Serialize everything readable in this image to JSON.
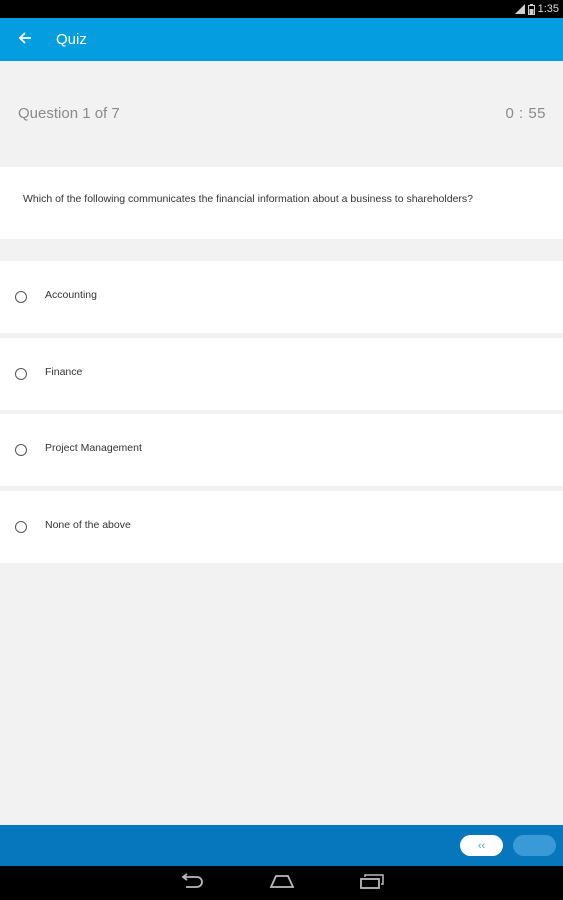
{
  "status_bar": {
    "time": "1:35",
    "icons": [
      "signal-icon",
      "battery-icon"
    ]
  },
  "app_bar": {
    "title": "Quiz",
    "back_icon": "arrow-left-icon"
  },
  "quiz": {
    "counter": "Question 1 of  7",
    "timer": "0 : 55",
    "question": "Which of the following communicates the financial information about a business to shareholders?",
    "options": [
      {
        "label": "Accounting"
      },
      {
        "label": "Finance"
      },
      {
        "label": "Project Management"
      },
      {
        "label": "None of the above"
      }
    ]
  },
  "bottom_bar": {
    "prev_label": "‹‹",
    "next_label": ""
  },
  "nav_bar": {
    "icons": [
      "back-nav-icon",
      "home-nav-icon",
      "recents-nav-icon"
    ]
  },
  "colors": {
    "app_bar": "#049ee0",
    "bottom_bar": "#0677bd",
    "background": "#f2f2f2"
  }
}
